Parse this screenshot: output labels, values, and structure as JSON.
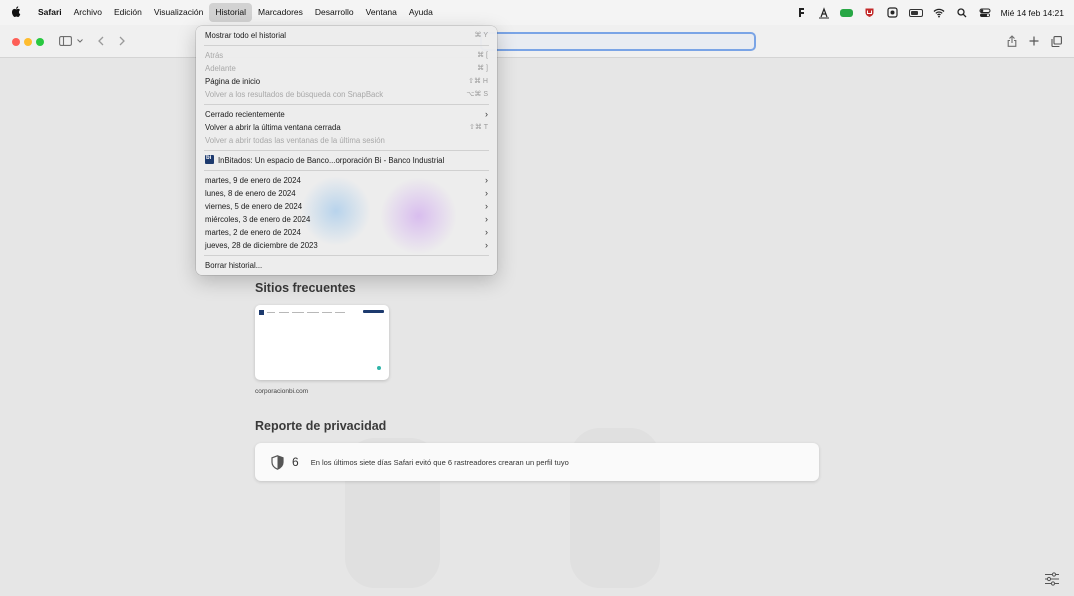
{
  "menubar": {
    "apple": "",
    "items": [
      "Safari",
      "Archivo",
      "Edición",
      "Visualización",
      "Historial",
      "Marcadores",
      "Desarrollo",
      "Ventana",
      "Ayuda"
    ],
    "active": "Historial",
    "datetime": "Mié 14 feb  14:21"
  },
  "history_menu": {
    "items": [
      {
        "label": "Mostrar todo el historial",
        "shortcut": "⌘ Y",
        "disabled": false
      },
      {
        "label": "Atrás",
        "shortcut": "⌘ [",
        "disabled": true
      },
      {
        "label": "Adelante",
        "shortcut": "⌘ ]",
        "disabled": true
      },
      {
        "label": "Página de inicio",
        "shortcut": "⇧⌘ H",
        "disabled": false
      },
      {
        "label": "Volver a los resultados de búsqueda con SnapBack",
        "shortcut": "⌥⌘ S",
        "disabled": true
      },
      {
        "label": "Cerrado recientemente",
        "submenu": true,
        "disabled": false
      },
      {
        "label": "Volver a abrir la última ventana cerrada",
        "shortcut": "⇧⌘ T",
        "disabled": false
      },
      {
        "label": "Volver a abrir todas las ventanas de la última sesión",
        "disabled": true
      },
      {
        "label": "InBitados: Un espacio de Banco...orporación Bi - Banco Industrial",
        "favicon": true,
        "disabled": false
      },
      {
        "label": "martes, 9 de enero de 2024",
        "submenu": true
      },
      {
        "label": "lunes, 8 de enero de 2024",
        "submenu": true
      },
      {
        "label": "viernes, 5 de enero de 2024",
        "submenu": true
      },
      {
        "label": "miércoles, 3 de enero de 2024",
        "submenu": true
      },
      {
        "label": "martes, 2 de enero de 2024",
        "submenu": true
      },
      {
        "label": "jueves, 28 de diciembre de 2023",
        "submenu": true
      },
      {
        "label": "Borrar historial...",
        "disabled": false
      }
    ]
  },
  "start_page": {
    "frequent_title": "Sitios frecuentes",
    "frequent_sites": [
      {
        "caption": "corporacionbi.com"
      }
    ],
    "privacy_title": "Reporte de privacidad",
    "privacy_count": "6",
    "privacy_message": "En los últimos siete días Safari evitó que 6 rastreadores crearan un perfil tuyo"
  },
  "colors": {
    "accent": "#7aa4e6",
    "close": "#fe5f57",
    "minimize": "#febc2e",
    "zoom": "#28c840"
  }
}
